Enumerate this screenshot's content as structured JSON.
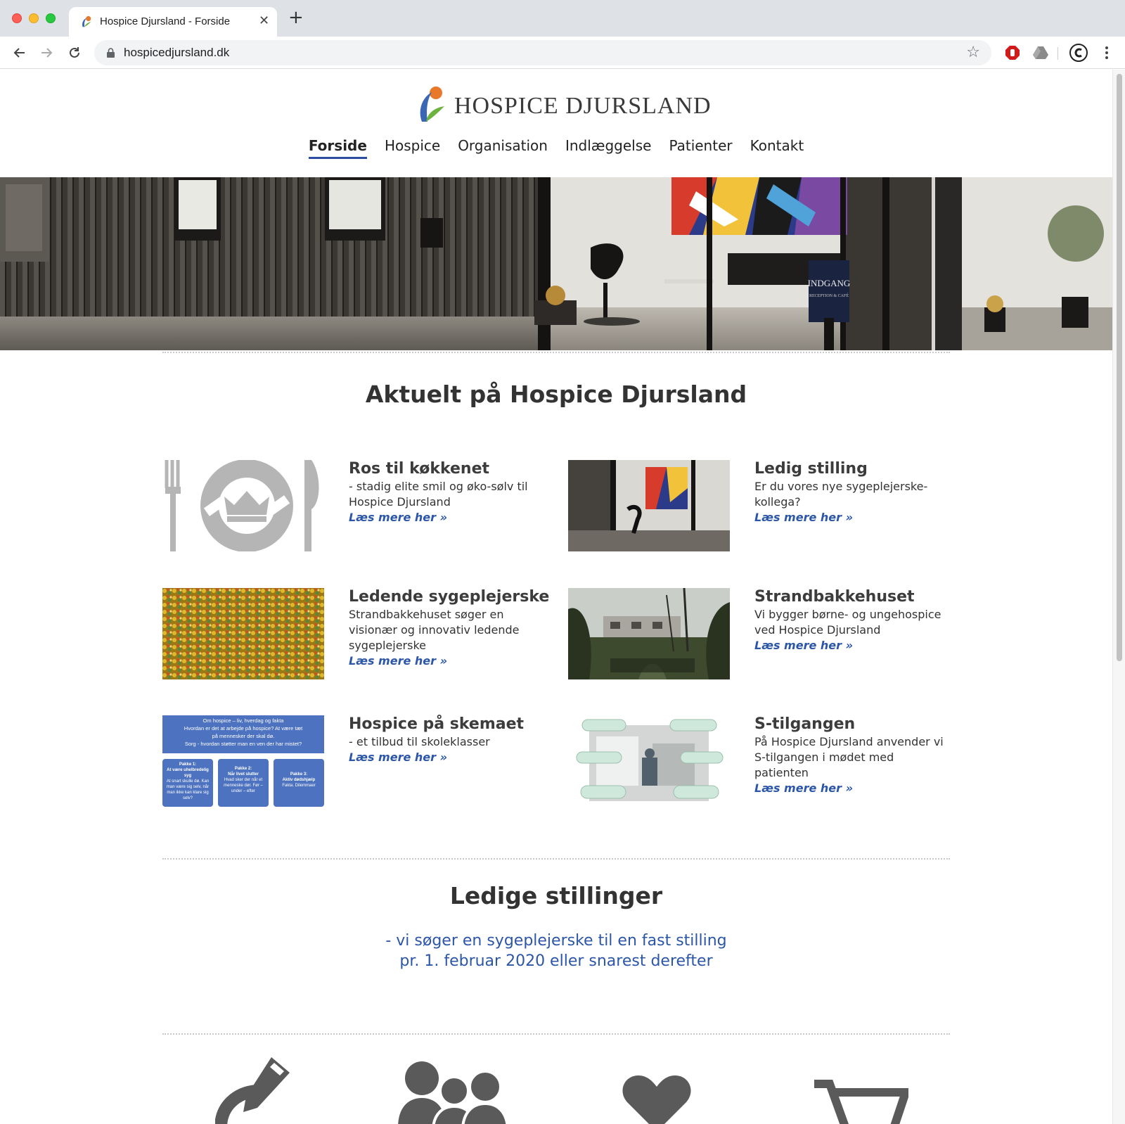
{
  "browser": {
    "tab_title": "Hospice Djursland - Forside",
    "tab_close": "✕",
    "new_tab": "+",
    "url": "hospicedjursland.dk"
  },
  "site": {
    "logo_text": "HOSPICE DJURSLAND",
    "nav": [
      {
        "label": "Forside",
        "active": true
      },
      {
        "label": "Hospice"
      },
      {
        "label": "Organisation"
      },
      {
        "label": "Indlæggelse"
      },
      {
        "label": "Patienter"
      },
      {
        "label": "Kontakt"
      }
    ],
    "hero_sign": "INDGANG",
    "hero_sign_sub": "RECEPTION & CAFÉ"
  },
  "news": {
    "heading": "Aktuelt på Hospice Djursland",
    "read_more": "Læs mere her »",
    "items": [
      {
        "title": "Ros til køkkenet",
        "text": "- stadig elite smil og øko-sølv til Hospice Djursland"
      },
      {
        "title": "Ledig stilling",
        "text": "Er du vores nye sygeplejerske-kollega?"
      },
      {
        "title": "Ledende sygeplejerske",
        "text": "Strandbakkehuset søger en visionær og innovativ ledende sygeplejerske"
      },
      {
        "title": "Strandbakkehuset",
        "text": "Vi bygger børne- og ungehospice ved Hospice Djursland"
      },
      {
        "title": "Hospice på skemaet",
        "text": "- et tilbud til skoleklasser"
      },
      {
        "title": "S-tilgangen",
        "text": "På Hospice Djursland anvender vi S-tilgangen i mødet med patienten"
      }
    ]
  },
  "school_thumb": {
    "header": [
      "Om hospice – liv, hverdag og fakta",
      "Hvordan er det at arbejde på hospice? At være tæt",
      "på mennesker der skal dø.",
      "Sorg - hvordan støtter man en ven der har mistet?"
    ],
    "boxes": [
      {
        "title": "Pakke 1:",
        "sub": "At være uhelbredelig syg",
        "text": "At snart skulle dø. Kan man være sig selv, når man ikke kan klare sig selv?"
      },
      {
        "title": "Pakke 2:",
        "sub": "Når livet slutter",
        "text": "Hvad sker der når et menneske dør. Før – under – efter"
      },
      {
        "title": "Pakke 3:",
        "sub": "Aktiv dødshjælp",
        "text": "Fakta. Dilemmaer"
      }
    ]
  },
  "jobs": {
    "heading": "Ledige stillinger",
    "line1": "- vi søger en sygeplejerske til en fast stilling",
    "line2": "pr. 1. februar 2020 eller snarest derefter"
  },
  "colors": {
    "accent": "#2c56a8",
    "nav_underline": "#2b4ea0",
    "icon_gray": "#5a5a5a"
  },
  "bottom_icons": [
    "pencil-icon",
    "people-icon",
    "heart-icon",
    "cart-icon"
  ]
}
